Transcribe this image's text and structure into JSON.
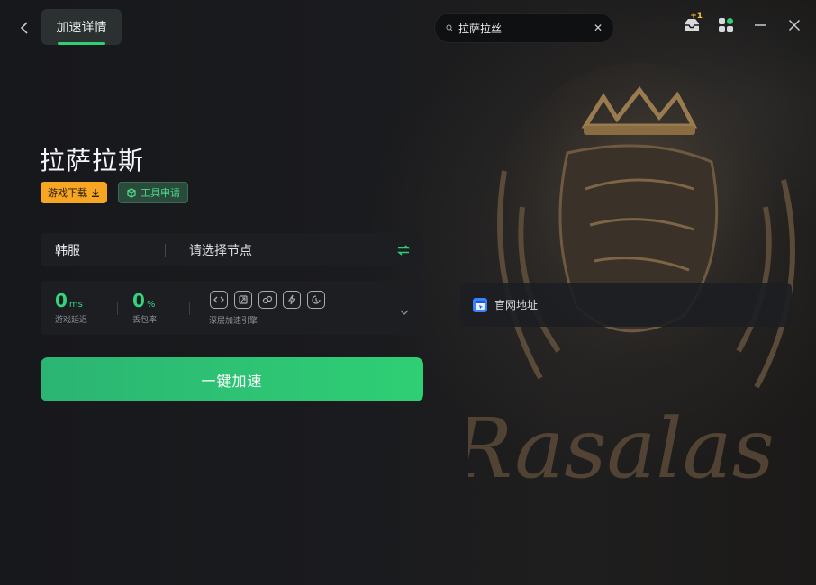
{
  "header": {
    "back_icon": "chevron-left-icon",
    "active_tab": "加速详情",
    "search": {
      "value": "拉萨拉丝",
      "placeholder": "",
      "search_icon": "search-icon",
      "clear_icon": "close-icon"
    },
    "icons": {
      "mail": {
        "name": "inbox-icon",
        "badge": "+1"
      },
      "apps": "apps-grid-icon",
      "minimize": "minimize-icon",
      "close": "close-icon"
    }
  },
  "game": {
    "title": "拉萨拉斯",
    "download_tag": "游戏下载",
    "tool_tag": "工具申请"
  },
  "server": {
    "region": "韩服",
    "node_placeholder": "请选择节点",
    "swap_icon": "swap-icon"
  },
  "stats": {
    "latency": {
      "value": "0",
      "unit": "ms",
      "label": "游戏延迟"
    },
    "packet_loss": {
      "value": "0",
      "unit": "%",
      "label": "丢包率"
    },
    "engine_label": "深层加速引擎",
    "engine_icons": [
      "link-icon",
      "screen-icon",
      "network-icon",
      "bolt-icon",
      "refresh-icon"
    ]
  },
  "accelerate_button": "一键加速",
  "official_link": {
    "label": "官网地址",
    "icon": "browser-icon"
  },
  "background": {
    "watermark_text": "Rasalas"
  },
  "colors": {
    "accent": "#2fcf74",
    "download_tag": "#f6a623",
    "badge": "#f3c43b"
  }
}
